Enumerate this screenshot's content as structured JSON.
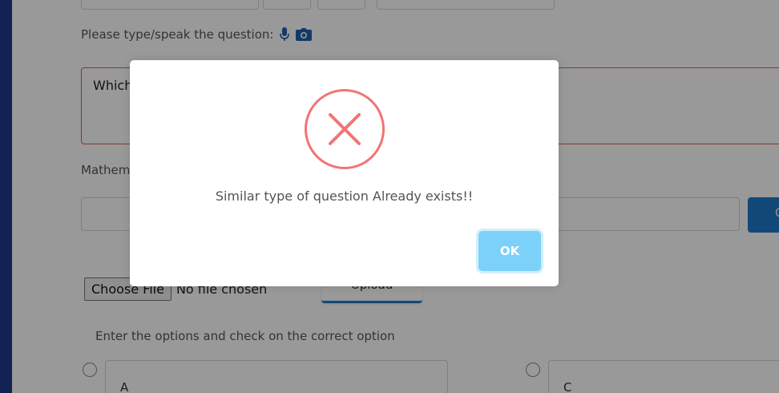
{
  "form": {
    "question_label": "Please type/speak the question:",
    "question_text": "Which",
    "math_label": "Mathem",
    "side_button_label": "C",
    "choose_file_label": "Choose File",
    "no_file_text": "No file chosen",
    "upload_label": "Upload",
    "options_label": "Enter the options and check on the correct option",
    "options": [
      {
        "label": "A"
      },
      {
        "label": "C"
      }
    ]
  },
  "icons": {
    "mic": "microphone-icon",
    "camera": "camera-icon",
    "error": "error-x-icon"
  },
  "modal": {
    "message": "Similar type of question Already exists!!",
    "ok_label": "OK"
  },
  "colors": {
    "left_bar": "#1d3a8a",
    "error_red": "#f27474",
    "ok_button": "#7cd1f9",
    "accent_blue": "#1f78c8",
    "question_border": "#e45858"
  }
}
